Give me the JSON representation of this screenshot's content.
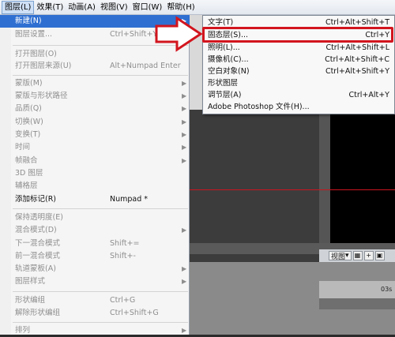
{
  "menubar": {
    "items": [
      {
        "label": "图层(L)",
        "active": true
      },
      {
        "label": "效果(T)"
      },
      {
        "label": "动画(A)"
      },
      {
        "label": "视图(V)"
      },
      {
        "label": "窗口(W)"
      },
      {
        "label": "帮助(H)"
      }
    ]
  },
  "layer_menu": {
    "items": [
      {
        "label": "新建(N)",
        "shortcut": "",
        "submenu": true,
        "highlighted": true
      },
      {
        "label": "图层设置...",
        "shortcut": "Ctrl+Shift+Y",
        "disabled": true
      },
      {
        "label": "打开图层(O)",
        "shortcut": "",
        "disabled": true
      },
      {
        "label": "打开图层来源(U)",
        "shortcut": "Alt+Numpad Enter",
        "disabled": true
      },
      {
        "label": "蒙版(M)",
        "shortcut": "",
        "submenu": true,
        "disabled": true
      },
      {
        "label": "蒙版与形状路径",
        "shortcut": "",
        "submenu": true,
        "disabled": true
      },
      {
        "label": "品质(Q)",
        "shortcut": "",
        "submenu": true,
        "disabled": true
      },
      {
        "label": "切换(W)",
        "shortcut": "",
        "submenu": true,
        "disabled": true
      },
      {
        "label": "变换(T)",
        "shortcut": "",
        "submenu": true,
        "disabled": true
      },
      {
        "label": "时间",
        "shortcut": "",
        "submenu": true,
        "disabled": true
      },
      {
        "label": "帧融合",
        "shortcut": "",
        "submenu": true,
        "disabled": true
      },
      {
        "label": "3D 图层",
        "shortcut": "",
        "disabled": true
      },
      {
        "label": "辅格层",
        "shortcut": "",
        "disabled": true
      },
      {
        "label": "添加标记(R)",
        "shortcut": "Numpad *",
        "disabled": false
      },
      {
        "label": "保持透明度(E)",
        "shortcut": "",
        "disabled": true
      },
      {
        "label": "混合模式(D)",
        "shortcut": "",
        "submenu": true,
        "disabled": true
      },
      {
        "label": "下一混合模式",
        "shortcut": "Shift+=",
        "disabled": true
      },
      {
        "label": "前一混合模式",
        "shortcut": "Shift+-",
        "disabled": true
      },
      {
        "label": "轨道蒙板(A)",
        "shortcut": "",
        "submenu": true,
        "disabled": true
      },
      {
        "label": "图层样式",
        "shortcut": "",
        "submenu": true,
        "disabled": true
      },
      {
        "label": "形状编组",
        "shortcut": "Ctrl+G",
        "disabled": true
      },
      {
        "label": "解除形状编组",
        "shortcut": "Ctrl+Shift+G",
        "disabled": true
      },
      {
        "label": "排列",
        "shortcut": "",
        "submenu": true,
        "disabled": true
      }
    ]
  },
  "new_submenu": {
    "items": [
      {
        "label": "文字(T)",
        "shortcut": "Ctrl+Alt+Shift+T"
      },
      {
        "label": "固态层(S)...",
        "shortcut": "Ctrl+Y",
        "highlighted": true
      },
      {
        "label": "照明(L)...",
        "shortcut": "Ctrl+Alt+Shift+L"
      },
      {
        "label": "摄像机(C)...",
        "shortcut": "Ctrl+Alt+Shift+C"
      },
      {
        "label": "空白对象(N)",
        "shortcut": "Ctrl+Alt+Shift+Y"
      },
      {
        "label": "形状图层",
        "shortcut": ""
      },
      {
        "label": "调节层(A)",
        "shortcut": "Ctrl+Alt+Y"
      },
      {
        "label": "Adobe Photoshop 文件(H)...",
        "shortcut": ""
      }
    ]
  },
  "viewer_toolbar": {
    "view_label": "视图",
    "time_label": "03s"
  },
  "colors": {
    "highlight": "#2f6fd1",
    "annotation_red": "#d2151e"
  },
  "icons": {
    "submenu_arrow": "▶",
    "dropdown_arrow": "▾"
  }
}
